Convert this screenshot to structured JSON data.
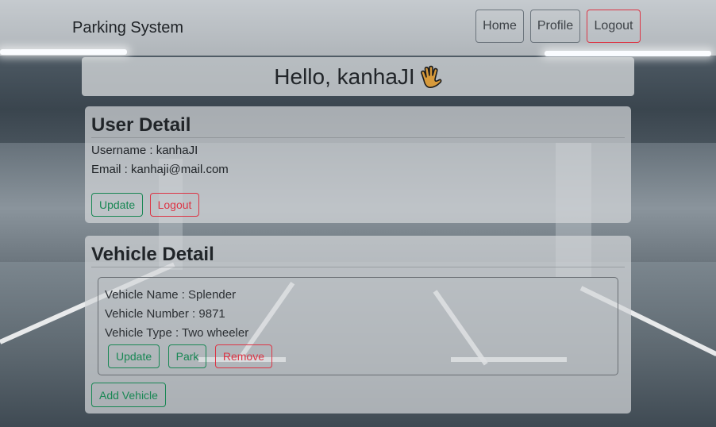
{
  "navbar": {
    "brand": "Parking System",
    "links": [
      {
        "label": "Home"
      },
      {
        "label": "Profile"
      },
      {
        "label": "Logout"
      }
    ]
  },
  "greeting": {
    "text": "Hello, kanhaJI",
    "emoji_icon": "waving-hand-icon"
  },
  "user_detail": {
    "title": "User Detail",
    "username_line": "Username : kanhaJI",
    "email_line": "Email : kanhaji@mail.com",
    "update_label": "Update",
    "logout_label": "Logout"
  },
  "vehicle_detail": {
    "title": "Vehicle Detail",
    "vehicles": [
      {
        "name_line": "Vehicle Name : Splender",
        "number_line": "Vehicle Number : 9871",
        "type_line": "Vehicle Type : Two wheeler",
        "update_label": "Update",
        "park_label": "Park",
        "remove_label": "Remove"
      }
    ],
    "add_label": "Add Vehicle"
  },
  "colors": {
    "success": "#198754",
    "danger": "#dc3545",
    "secondary": "#6c757d"
  }
}
